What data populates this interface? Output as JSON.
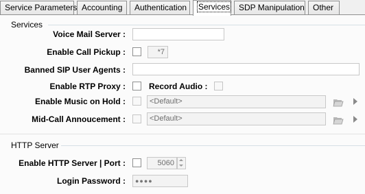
{
  "tabs": [
    {
      "label": "Service Parameters"
    },
    {
      "label": "Accounting"
    },
    {
      "label": "Authentication"
    },
    {
      "label": "Services"
    },
    {
      "label": "SDP Manipulation"
    },
    {
      "label": "Other"
    }
  ],
  "active_tab": "Services",
  "services": {
    "title": "Services",
    "voice_mail_server": {
      "label": "Voice Mail Server :",
      "value": ""
    },
    "enable_call_pickup": {
      "label": "Enable Call Pickup :",
      "checked": false,
      "code": "*7"
    },
    "banned_sip_user_agents": {
      "label": "Banned SIP User Agents :",
      "value": ""
    },
    "enable_rtp_proxy": {
      "label": "Enable RTP Proxy :",
      "checked": false
    },
    "record_audio": {
      "label": "Record Audio :",
      "checked": false
    },
    "enable_music_on_hold": {
      "label": "Enable Music on Hold :",
      "checked": false,
      "value": "<Default>"
    },
    "mid_call_announcement": {
      "label": "Mid-Call Annoucement :",
      "checked": false,
      "value": "<Default>"
    }
  },
  "http_server": {
    "title": "HTTP Server",
    "enable": {
      "label": "Enable HTTP Server | Port :",
      "checked": false,
      "port": "5060"
    },
    "login_password": {
      "label": "Login Password :",
      "value": "●●●●"
    }
  }
}
